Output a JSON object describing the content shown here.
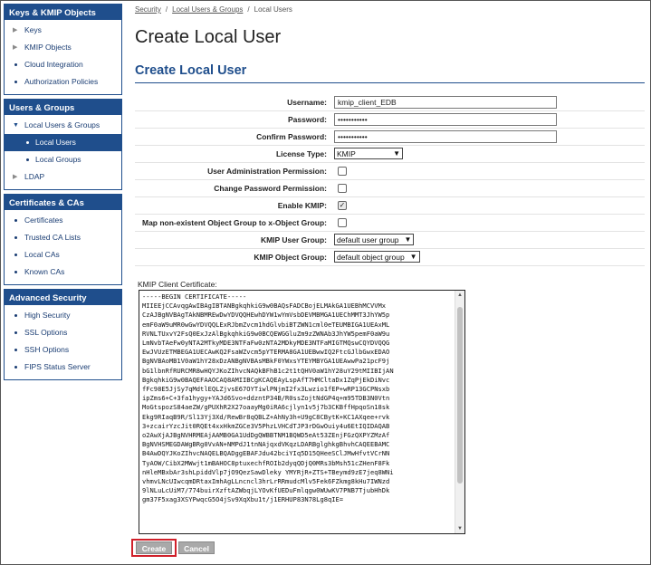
{
  "sidebar": {
    "keys_panel": {
      "title": "Keys & KMIP Objects",
      "items": [
        "Keys",
        "KMIP Objects",
        "Cloud Integration",
        "Authorization Policies"
      ]
    },
    "users_panel": {
      "title": "Users & Groups",
      "items": [
        "Local Users & Groups",
        "Local Users",
        "Local Groups",
        "LDAP"
      ]
    },
    "certs_panel": {
      "title": "Certificates & CAs",
      "items": [
        "Certificates",
        "Trusted CA Lists",
        "Local CAs",
        "Known CAs"
      ]
    },
    "security_panel": {
      "title": "Advanced Security",
      "items": [
        "High Security",
        "SSL Options",
        "SSH Options",
        "FIPS Status Server"
      ]
    }
  },
  "breadcrumb": {
    "item1": "Security",
    "item2": "Local Users & Groups",
    "current": "Local Users",
    "sep": "/"
  },
  "page_title": "Create Local User",
  "section_title": "Create Local User",
  "form": {
    "username_label": "Username:",
    "username_value": "kmip_client_EDB",
    "password_label": "Password:",
    "password_value": "•••••••••••",
    "confirm_label": "Confirm Password:",
    "confirm_value": "•••••••••••",
    "license_label": "License Type:",
    "license_value": "KMIP",
    "user_admin_label": "User Administration Permission:",
    "change_pw_label": "Change Password Permission:",
    "enable_kmip_label": "Enable KMIP:",
    "enable_kmip_checked": "✓",
    "map_label": "Map non-existent Object Group to x-Object Group:",
    "kmip_user_group_label": "KMIP User Group:",
    "kmip_user_group_value": "default user group",
    "kmip_object_group_label": "KMIP Object Group:",
    "kmip_object_group_value": "default object group",
    "cert_label": "KMIP Client Certificate:",
    "cert_text": "-----BEGIN CERTIFICATE-----\nMIIEEjCCAvqgAwIBAgIBTANBgkqhkiG9w0BAQsFADCBojELMAkGA1UEBhMCVVMx\nCzAJBgNVBAgTAkNBMREwDwYDVQQHEwhDYW1wYmVsbDEVMBMGA1UEChMMT3JhYW5p\nemF0aW9uMR0wGwYDVQQLExRJbmZvcm1hdGlvbiBTZWN1cml0eTEUMBIGA1UEAxML\nRVNLTUxvY2FsQ0ExJzAlBgkqhkiG9w0BCQEWGGluZm9zZWNAb3JhYW5pemF0aW9u\nLmNvbTAeFw0yNTA2MTkyMDE3NTFaFw0zNTA2MDkyMDE3NTFaMIGTMQswCQYDVQQG\nEwJVUzETMBEGA1UECAwKQ2FsaWZvcm5pYTERMA8GA1UEBwwIQ2FtcGJlbGwxEDAO\nBgNVBAoMB1V0aW1hY28xDzANBgNVBAsMBkF0YWxsYTEYMBYGA1UEAwwPa21pcF9j\nbG1lbnRfRURCMR8wHQYJKoZIhvcNAQkBFhB1c2t1tQHV0aW1hY28uY29tMIIBIjAN\nBgkqhkiG9w0BAQEFAAOCAQ8AMIIBCgKCAQEAyLspAfT7HMCltaDx1ZqPjEkDiNvc\nfFc98E5JjSy7qMdtlEQLZjvsE67OYTiwlPNjmI2fx3Lwzio1fEP+wRP13GCPNsxb\nipZms6+C+3fa1hygy+YAJd6Svo+ddzntP34B/R0ssZojtNdGP4q+m95TDB3N0Vtn\nMoGtspozS84aeZW/gPUXhR2X27oaayMg0iRA6cjlyn1v5j7b3CKBffHpqoSn18sk\nEkg9RIaqB9R/Sl13Yj3Xd/RewBr8qQBLZ+AhNy3h+U9gC8CBytK+KC1AXqee+rvk\n3+zcairYzcJit0RQEt4xxHkmZGCe3V5PhzLVHCdTJP3rDGwOuiy4u6EtIQIDAQAB\no2AwXjAJBgNVHRMEAjAAMB0GA1UdDgQWBBTNM1BQWD5eAt53ZEnjFGzQXPYZMzAf\nBgNVHSMEGDAWgBRg0VvAN+NMPdJ1tnNAjqxdVKqzLDARBglghkgBhvhCAQEEBAMC\nB4AwDQYJKoZIhvcNAQELBQADggEBAFJdu42bciYIq5D15QHeeSClJMwHfvtVCrNN\nTyAOW/CibX2MWwjt1mBAHOC8ptuxechfROIb2dyqQDjQ0MRs3bMsh51cZHenF8Fk\nnHleMBxbAr3shLpiddVlp7jO9QezSawDleky YMYRjR+ZTS+TBeymd9zE7jeq8WNi\nvhmvLNcUIwcqmDRtaxImhAgLLncncl3hrLrRRmudcMlv5Fek6FZkmg8kHu7IWNzd\n9lNLuLcUiM7/774buirXzftAZWbqjLYOvKfUEDuFmlqgw0WUwKV7PNB7TjubHhDk\ngm37F5xag3XSYPwqcG5O4jSv9XqXbu1t/j1ERHUP83N78Lg8qIE=",
    "create_label": "Create",
    "cancel_label": "Cancel"
  }
}
